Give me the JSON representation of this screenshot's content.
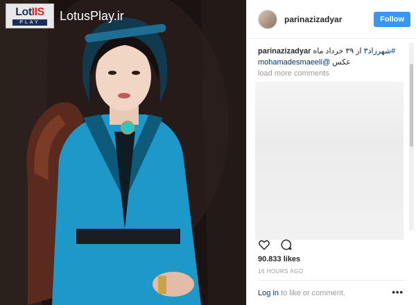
{
  "watermark": {
    "logo_top": "Lot",
    "logo_accent": "IIS",
    "logo_bottom": "PLAY",
    "site": "LotusPlay.ir"
  },
  "post": {
    "username": "parinazizadyar",
    "follow_label": "Follow",
    "caption_user": "parinazizadyar",
    "caption_hashtag": "#شهرزاد۳",
    "caption_text": " از ۳۹ خرداد ماه ",
    "caption_line2_prefix": "عکس ",
    "caption_mention": "@mohamadesmaeeli",
    "load_more": "load more comments",
    "likes": "90.833 likes",
    "time": "16 HOURS AGO",
    "login_link": "Log in",
    "login_text": " to like or comment.",
    "more_label": "•••"
  },
  "icons": {
    "like": "heart-icon",
    "comment": "comment-icon",
    "more": "more-options-icon"
  },
  "colors": {
    "follow_button": "#3897f0",
    "link": "#003569",
    "dress": "#1e97c9"
  }
}
